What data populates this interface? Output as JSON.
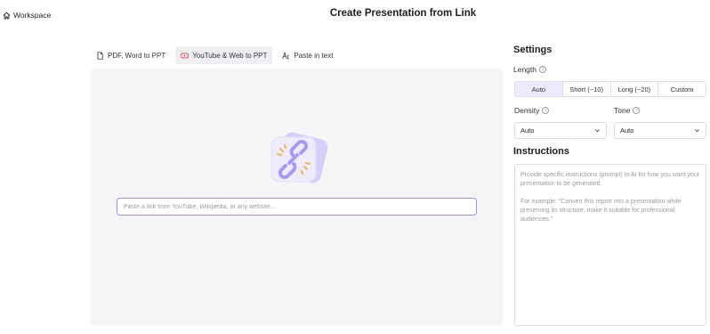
{
  "header": {
    "back_label": "Workspace",
    "title": "Create Presentation from Link"
  },
  "tabs": [
    {
      "label": "PDF, Word to PPT",
      "icon": "document-icon",
      "active": false
    },
    {
      "label": "YouTube & Web to PPT",
      "icon": "youtube-icon",
      "active": true
    },
    {
      "label": "Paste in text",
      "icon": "text-icon",
      "active": false
    }
  ],
  "link_input": {
    "value": "",
    "placeholder": "Paste a link from YouTube, Wikipedia, or any website..."
  },
  "settings": {
    "title": "Settings",
    "length": {
      "label": "Length",
      "options": [
        "Auto",
        "Short (~10)",
        "Long (~20)",
        "Custom"
      ],
      "selected": "Auto"
    },
    "density": {
      "label": "Density",
      "value": "Auto"
    },
    "tone": {
      "label": "Tone",
      "value": "Auto"
    }
  },
  "instructions": {
    "title": "Instructions",
    "placeholder_1": "Provide specific instructions (prompt) to AI for how you want your presentation to be generated.",
    "placeholder_2": "For example: \"Convert this report into a presentation while preserving its structure, make it suitable for professional audiences.\""
  },
  "colors": {
    "accent": "#9b8fe6",
    "accent_light": "#eceaff",
    "stage_bg": "#f5f5f8"
  }
}
